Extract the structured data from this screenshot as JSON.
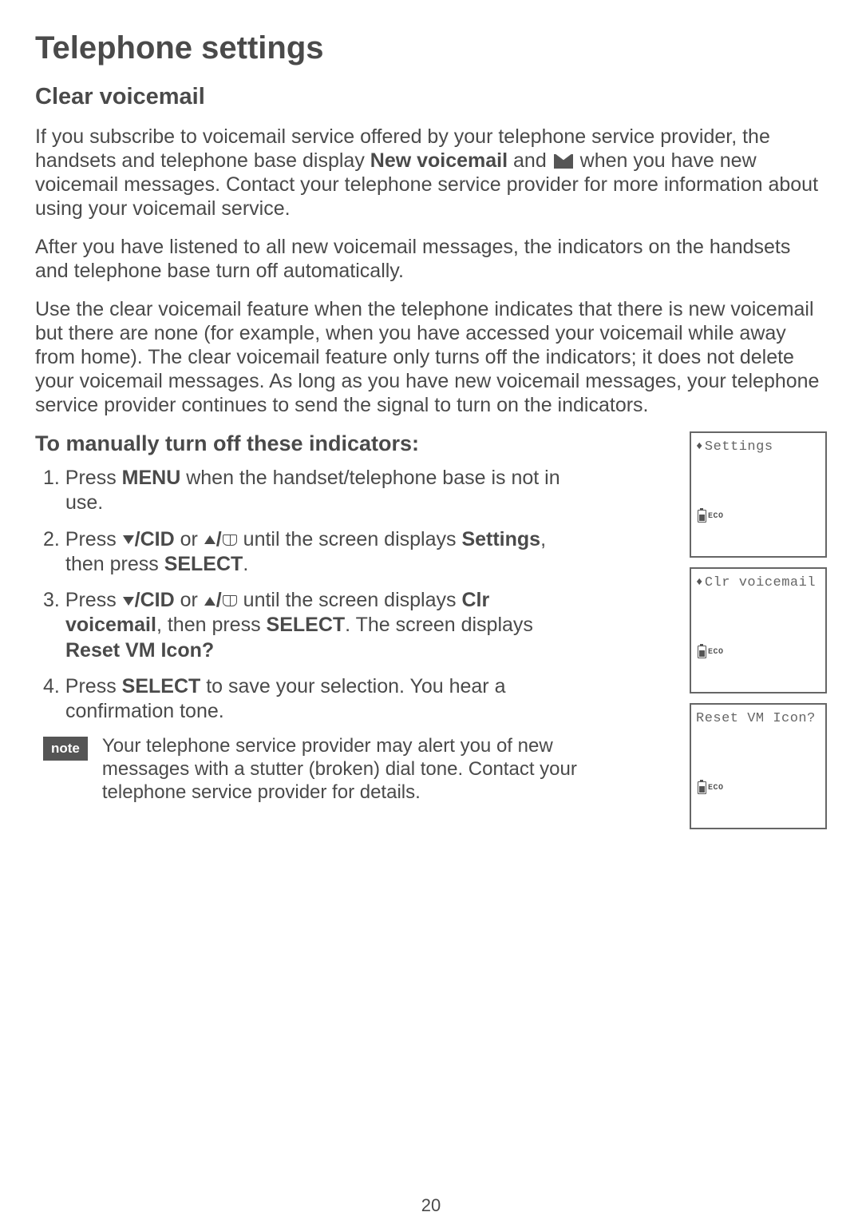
{
  "pageTitle": "Telephone settings",
  "section": {
    "title": "Clear voicemail",
    "para1_before": "If you subscribe to voicemail service offered by your telephone service provider, the handsets and telephone base display ",
    "para1_bold1": "New voicemail",
    "para1_mid": " and ",
    "para1_after": " when you have new voicemail messages. Contact your telephone service provider for more information about using your voicemail service.",
    "para2": "After you have listened to all new voicemail messages, the indicators on the handsets and telephone base turn off automatically.",
    "para3": "Use the clear voicemail feature when the telephone indicates that there is new voicemail but there are none (for example, when you have accessed your voicemail while away from home). The clear voicemail feature only turns off the indicators; it does not delete your voicemail messages. As long as you have new voicemail messages, your telephone service provider continues to send the signal to turn on the indicators."
  },
  "instructions": {
    "title": "To manually turn off these indicators:",
    "steps": [
      {
        "num": "1. ",
        "a": "Press ",
        "b": "MENU",
        "c": " when the handset/telephone base is not in use."
      },
      {
        "num": "2. ",
        "a": "Press ",
        "cid": "/CID",
        "or": " or ",
        "until": " until the screen displays ",
        "target": "Settings",
        "then": ", then press ",
        "sel": "SELECT",
        "end": "."
      },
      {
        "num": "3. ",
        "a": "Press ",
        "cid": "/CID",
        "or": " or ",
        "until": " until the screen displays ",
        "target": "Clr voicemail",
        "then": ", then press ",
        "sel": "SELECT",
        "end2": ". The screen displays ",
        "reset": "Reset VM Icon?"
      },
      {
        "num": "4. ",
        "a": "Press ",
        "sel": "SELECT",
        "after": " to save your selection. You hear a confirmation tone."
      }
    ]
  },
  "note": {
    "label": "note",
    "text": "Your telephone service provider may alert you of new messages with a stutter (broken) dial tone. Contact your telephone service provider for details."
  },
  "screens": [
    {
      "line1": "Settings",
      "arrows": true,
      "eco": "ECO"
    },
    {
      "line1": "Clr voicemail",
      "arrows": true,
      "eco": "ECO"
    },
    {
      "line1": "Reset VM Icon?",
      "arrows": false,
      "eco": "ECO"
    }
  ],
  "pageNumber": "20"
}
